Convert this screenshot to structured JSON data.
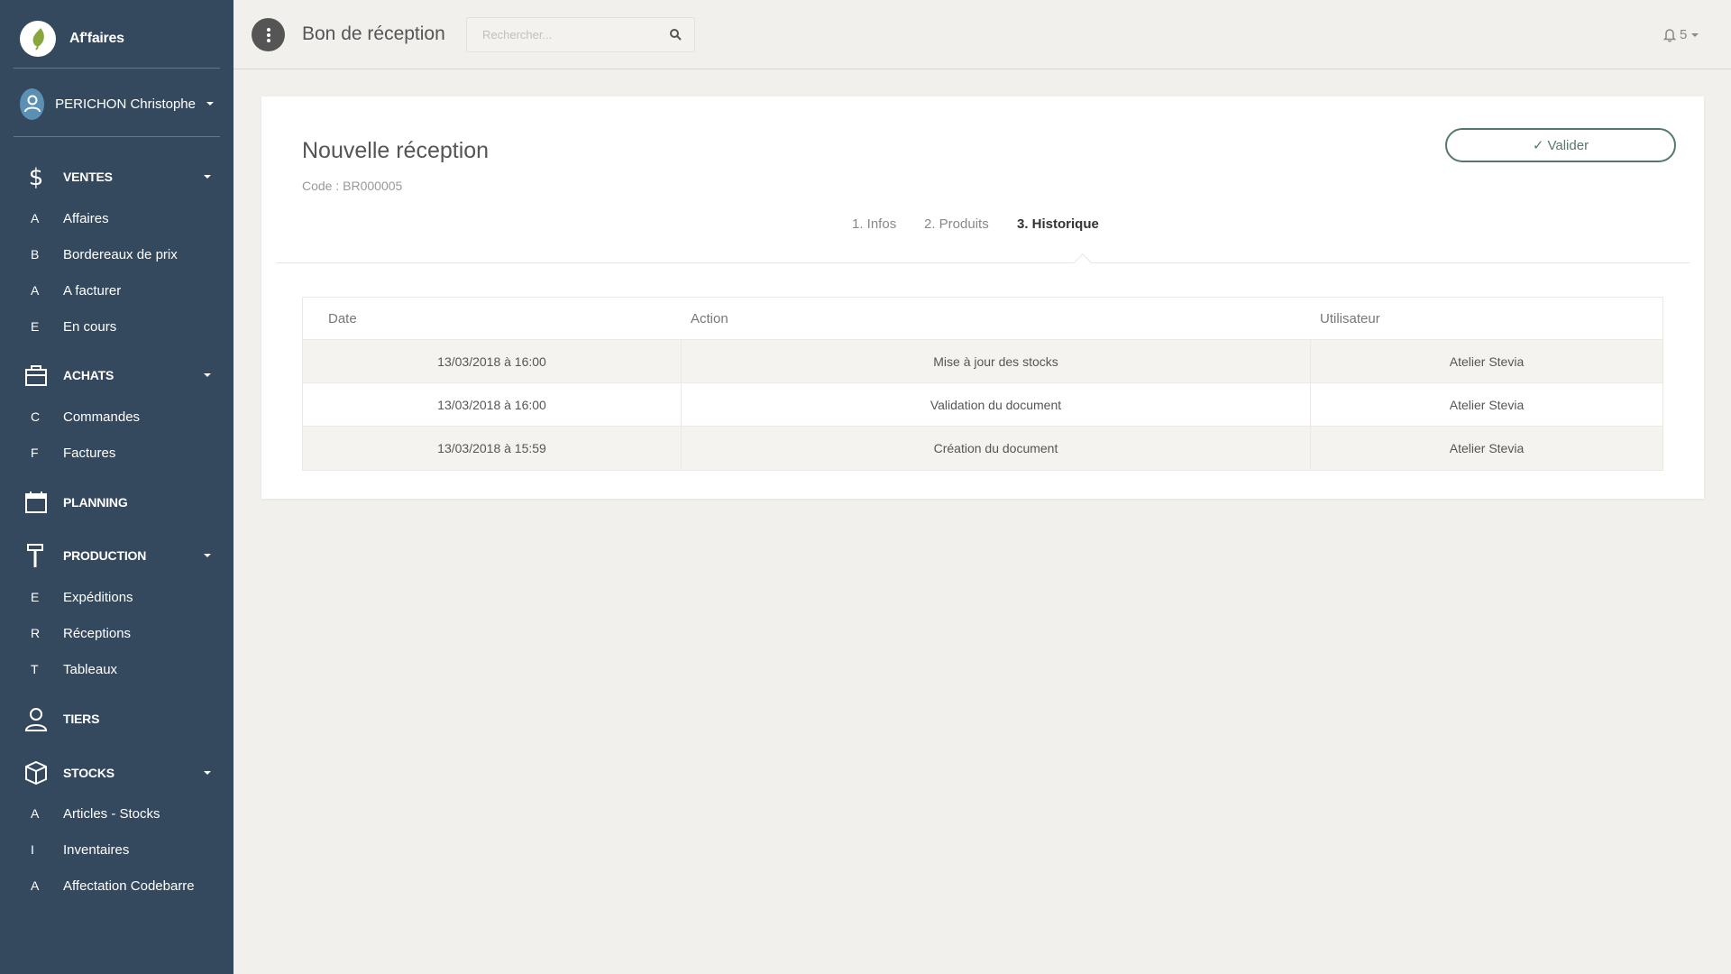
{
  "sidebar": {
    "brand": "Af'faires",
    "user": "PERICHON Christophe",
    "sections": [
      {
        "label": "VENTES",
        "icon": "dollar-icon",
        "items": [
          {
            "letter": "A",
            "label": "Affaires"
          },
          {
            "letter": "B",
            "label": "Bordereaux de prix"
          },
          {
            "letter": "A",
            "label": "A facturer"
          },
          {
            "letter": "E",
            "label": "En cours"
          }
        ]
      },
      {
        "label": "ACHATS",
        "icon": "briefcase-icon",
        "items": [
          {
            "letter": "C",
            "label": "Commandes"
          },
          {
            "letter": "F",
            "label": "Factures"
          }
        ]
      },
      {
        "label": "PLANNING",
        "icon": "calendar-icon",
        "items": []
      },
      {
        "label": "PRODUCTION",
        "icon": "hammer-icon",
        "items": [
          {
            "letter": "E",
            "label": "Expéditions"
          },
          {
            "letter": "R",
            "label": "Réceptions"
          },
          {
            "letter": "T",
            "label": "Tableaux"
          }
        ]
      },
      {
        "label": "TIERS",
        "icon": "person-icon",
        "items": []
      },
      {
        "label": "STOCKS",
        "icon": "box-icon",
        "items": [
          {
            "letter": "A",
            "label": "Articles - Stocks"
          },
          {
            "letter": "I",
            "label": "Inventaires"
          },
          {
            "letter": "A",
            "label": "Affectation Codebarre"
          }
        ]
      }
    ]
  },
  "header": {
    "title": "Bon de réception",
    "search_placeholder": "Rechercher...",
    "notifications": "5"
  },
  "card": {
    "title": "Nouvelle réception",
    "code": "Code : BR000005",
    "validate_label": "Valider",
    "tabs": [
      {
        "label": "1. Infos",
        "active": false
      },
      {
        "label": "2. Produits",
        "active": false
      },
      {
        "label": "3. Historique",
        "active": true
      }
    ],
    "table": {
      "headers": [
        "Date",
        "Action",
        "Utilisateur"
      ],
      "rows": [
        {
          "date": "13/03/2018 à 16:00",
          "action": "Mise à jour des stocks",
          "user": "Atelier Stevia"
        },
        {
          "date": "13/03/2018 à 16:00",
          "action": "Validation du document",
          "user": "Atelier Stevia"
        },
        {
          "date": "13/03/2018 à 15:59",
          "action": "Création du document",
          "user": "Atelier Stevia"
        }
      ]
    }
  },
  "colors": {
    "sidebar_bg": "#34495e",
    "page_bg": "#f1f0ed",
    "accent": "#55786e",
    "logo_leaf": "#8aa53b"
  }
}
